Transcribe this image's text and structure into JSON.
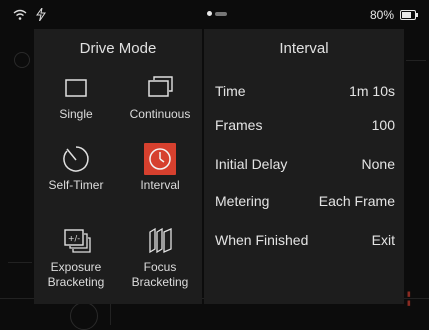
{
  "status_bar": {
    "battery_percent": "80%"
  },
  "drive_mode": {
    "title": "Drive Mode",
    "options": [
      {
        "label": "Single",
        "icon": "single-frame-icon",
        "selected": false
      },
      {
        "label": "Continuous",
        "icon": "continuous-icon",
        "selected": false
      },
      {
        "label": "Self-Timer",
        "icon": "self-timer-icon",
        "selected": false
      },
      {
        "label": "Interval",
        "icon": "interval-icon",
        "selected": true
      },
      {
        "label": "Exposure Bracketing",
        "icon": "exposure-bracketing-icon",
        "selected": false
      },
      {
        "label": "Focus Bracketing",
        "icon": "focus-bracketing-icon",
        "selected": false
      }
    ]
  },
  "interval": {
    "title": "Interval",
    "settings": [
      {
        "label": "Time",
        "value": "1m 10s"
      },
      {
        "label": "Frames",
        "value": "100"
      },
      {
        "label": "Initial Delay",
        "value": "None"
      },
      {
        "label": "Metering",
        "value": "Each Frame"
      },
      {
        "label": "When Finished",
        "value": "Exit"
      }
    ]
  },
  "colors": {
    "accent": "#d6402e",
    "panel": "#1d1d1d",
    "background": "#0c0c0c"
  }
}
